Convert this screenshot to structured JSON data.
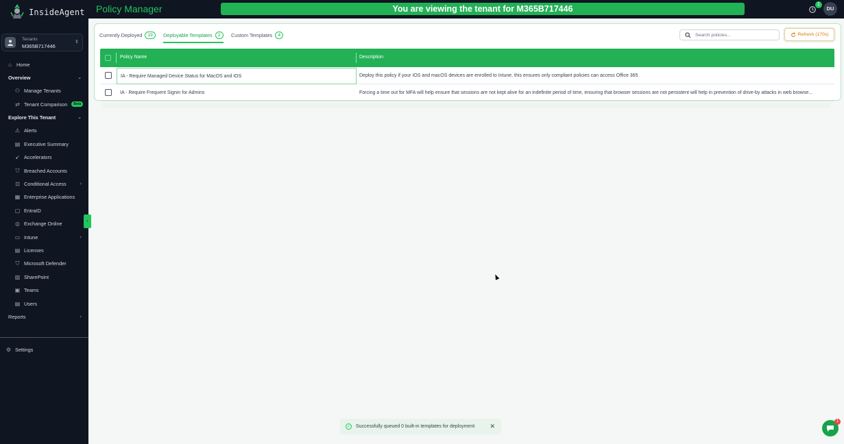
{
  "app": {
    "brand": "InsideAgent",
    "page_title": "Policy Manager"
  },
  "banner": {
    "text": "You are viewing the tenant for M365B717446"
  },
  "topbar": {
    "notification_count": "1",
    "user_initials": "DU"
  },
  "tenant": {
    "label": "Tenants",
    "value": "M365B717446"
  },
  "sidebar": {
    "home": "Home",
    "overview": "Overview",
    "manage_tenants": "Manage Tenants",
    "tenant_comparison": "Tenant Comparison",
    "beta": "Beta",
    "explore": "Explore This Tenant",
    "alerts": "Alerts",
    "executive_summary": "Executive Summary",
    "accelerators": "Accelerators",
    "breached_accounts": "Breached Accounts",
    "conditional_access": "Conditional Access",
    "enterprise_applications": "Enterprise Applications",
    "entraid": "EntraID",
    "exchange_online": "Exchange Online",
    "intune": "Intune",
    "licenses": "Licenses",
    "microsoft_defender": "Microsoft Defender",
    "sharepoint": "SharePoint",
    "teams": "Teams",
    "users": "Users",
    "reports": "Reports",
    "settings": "Settings"
  },
  "tabs": [
    {
      "label": "Currently Deployed",
      "count": "19"
    },
    {
      "label": "Deployable Templates",
      "count": "2"
    },
    {
      "label": "Custom Templates",
      "count": "4"
    }
  ],
  "search": {
    "placeholder": "Search policies..."
  },
  "refresh": {
    "label": "Refresh (170s)"
  },
  "table": {
    "headers": {
      "name": "Policy Name",
      "description": "Description"
    },
    "rows": [
      {
        "name": "IA - Require Managed Device Status for MacOS and IOS",
        "description": "Deploy this policy if your IOS and macOS devices are enrolled to Intune, this ensures only compliant policies can access Office 365"
      },
      {
        "name": "IA - Require Frequent Signin for Admins",
        "description": "Forcing a time out for MFA will help ensure that sessions are not kept alive for an indefinite period of time, ensuring that browser sessions are not persistent will help in prevention of drive-by attacks in web browse..."
      }
    ]
  },
  "toast": {
    "text": "Successfully queued 0 built-in templates for deployment"
  },
  "chat": {
    "badge": "1"
  },
  "colors": {
    "accent": "#22b155",
    "sidebar_bg": "#0f1521",
    "warning": "#d97706"
  }
}
